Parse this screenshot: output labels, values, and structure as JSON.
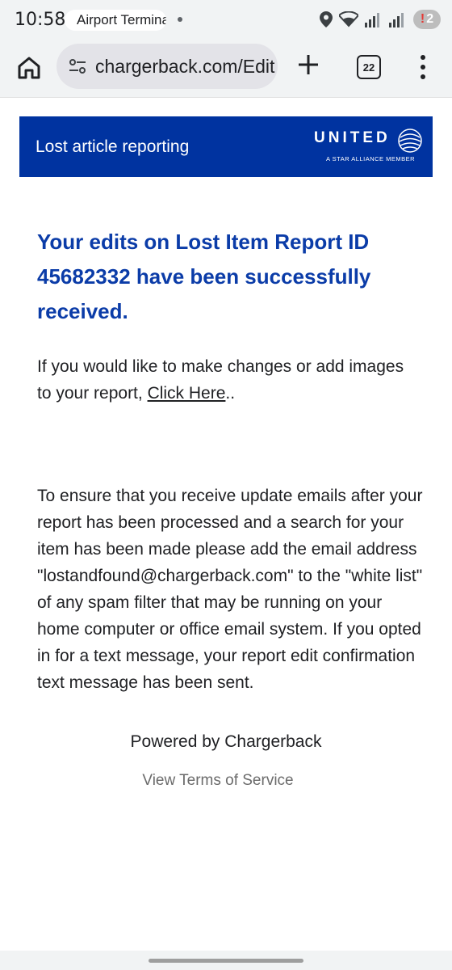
{
  "status_bar": {
    "time": "10:58",
    "notification_text": "Airport Terminal",
    "battery_badge": "2",
    "battery_alert": "!"
  },
  "browser": {
    "url": "chargerback.com/Edit",
    "tab_count": "22"
  },
  "banner": {
    "title": "Lost article reporting",
    "logo_word": "UNITED",
    "logo_tagline": "A STAR ALLIANCE MEMBER",
    "background_color": "#0033a0"
  },
  "content": {
    "headline": "Your edits on Lost Item Report ID 45682332 have been successfully received.",
    "para1_before_link": "If you would like to make changes or add images to your report, ",
    "para1_link": "Click Here",
    "para1_after_link": "..",
    "para2": "To ensure that you receive update emails after your report has been processed and a search for your item has been made please add the email address \"lostandfound@chargerback.com\" to the \"white list\" of any spam filter that may be running on your home computer or office email system. If you opted in for a text message, your report edit confirmation text message has been sent.",
    "powered_by": "Powered by Chargerback",
    "terms_link": "View Terms of Service",
    "headline_color": "#0b3ca8"
  }
}
